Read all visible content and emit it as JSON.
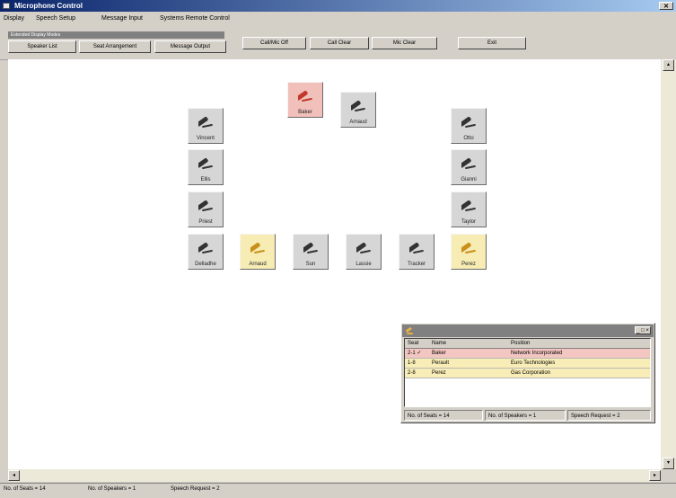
{
  "window": {
    "title": "Microphone Control",
    "close_label": "✕"
  },
  "menu": [
    "Display",
    "Speech Setup",
    "Message Input",
    "Systems Remote Control"
  ],
  "toolbar": {
    "group_caption": "Extended Display Modes",
    "tabs": [
      "Speaker List",
      "Seat Arrangement",
      "Message Output"
    ],
    "buttons": [
      "Call/Mic Off",
      "Call Clear",
      "Mic Clear",
      "Exit"
    ]
  },
  "seats": [
    {
      "id": "baker",
      "name": "Baker",
      "state": "speaking"
    },
    {
      "id": "arnaud-top",
      "name": "Arnaud",
      "state": "idle"
    },
    {
      "id": "vincent",
      "name": "Vincent",
      "state": "idle"
    },
    {
      "id": "ellis",
      "name": "Ellis",
      "state": "idle"
    },
    {
      "id": "priest",
      "name": "Priest",
      "state": "idle"
    },
    {
      "id": "delladhe",
      "name": "Delladhe",
      "state": "idle"
    },
    {
      "id": "arnaud-bottom",
      "name": "Arnaud",
      "state": "request"
    },
    {
      "id": "sun",
      "name": "Sun",
      "state": "idle"
    },
    {
      "id": "lassie",
      "name": "Lassie",
      "state": "idle"
    },
    {
      "id": "tracker",
      "name": "Tracker",
      "state": "idle"
    },
    {
      "id": "perez",
      "name": "Perez",
      "state": "request"
    },
    {
      "id": "otto",
      "name": "Otto",
      "state": "idle"
    },
    {
      "id": "gianni",
      "name": "Gianni",
      "state": "idle"
    },
    {
      "id": "taylor",
      "name": "Taylor",
      "state": "idle"
    }
  ],
  "speaker_list": {
    "columns": [
      "Seat",
      "Name",
      "Position"
    ],
    "rows": [
      {
        "seat": "2-1 ✓",
        "name": "Baker",
        "position": "Network Incorporated",
        "state": "speaking"
      },
      {
        "seat": "1-8",
        "name": "Perault",
        "position": "Euro Technologies",
        "state": "request"
      },
      {
        "seat": "2-8",
        "name": "Perez",
        "position": "Gas Corporation",
        "state": "request"
      }
    ],
    "status": [
      "No. of Seats = 14",
      "No. of Speakers = 1",
      "Speech Request = 2"
    ],
    "controls_label": "_ □ ×"
  },
  "status_bar": [
    "No. of Seats = 14",
    "No. of Speakers = 1",
    "Speech Request = 2"
  ],
  "scroll": {
    "left": "◂",
    "right": "▸",
    "up": "▴",
    "down": "▾"
  },
  "colors": {
    "speaking": "#f2c0bb",
    "request": "#f6ecb4",
    "idle": "#d6d6d6",
    "title_bar": "#0a246a"
  }
}
